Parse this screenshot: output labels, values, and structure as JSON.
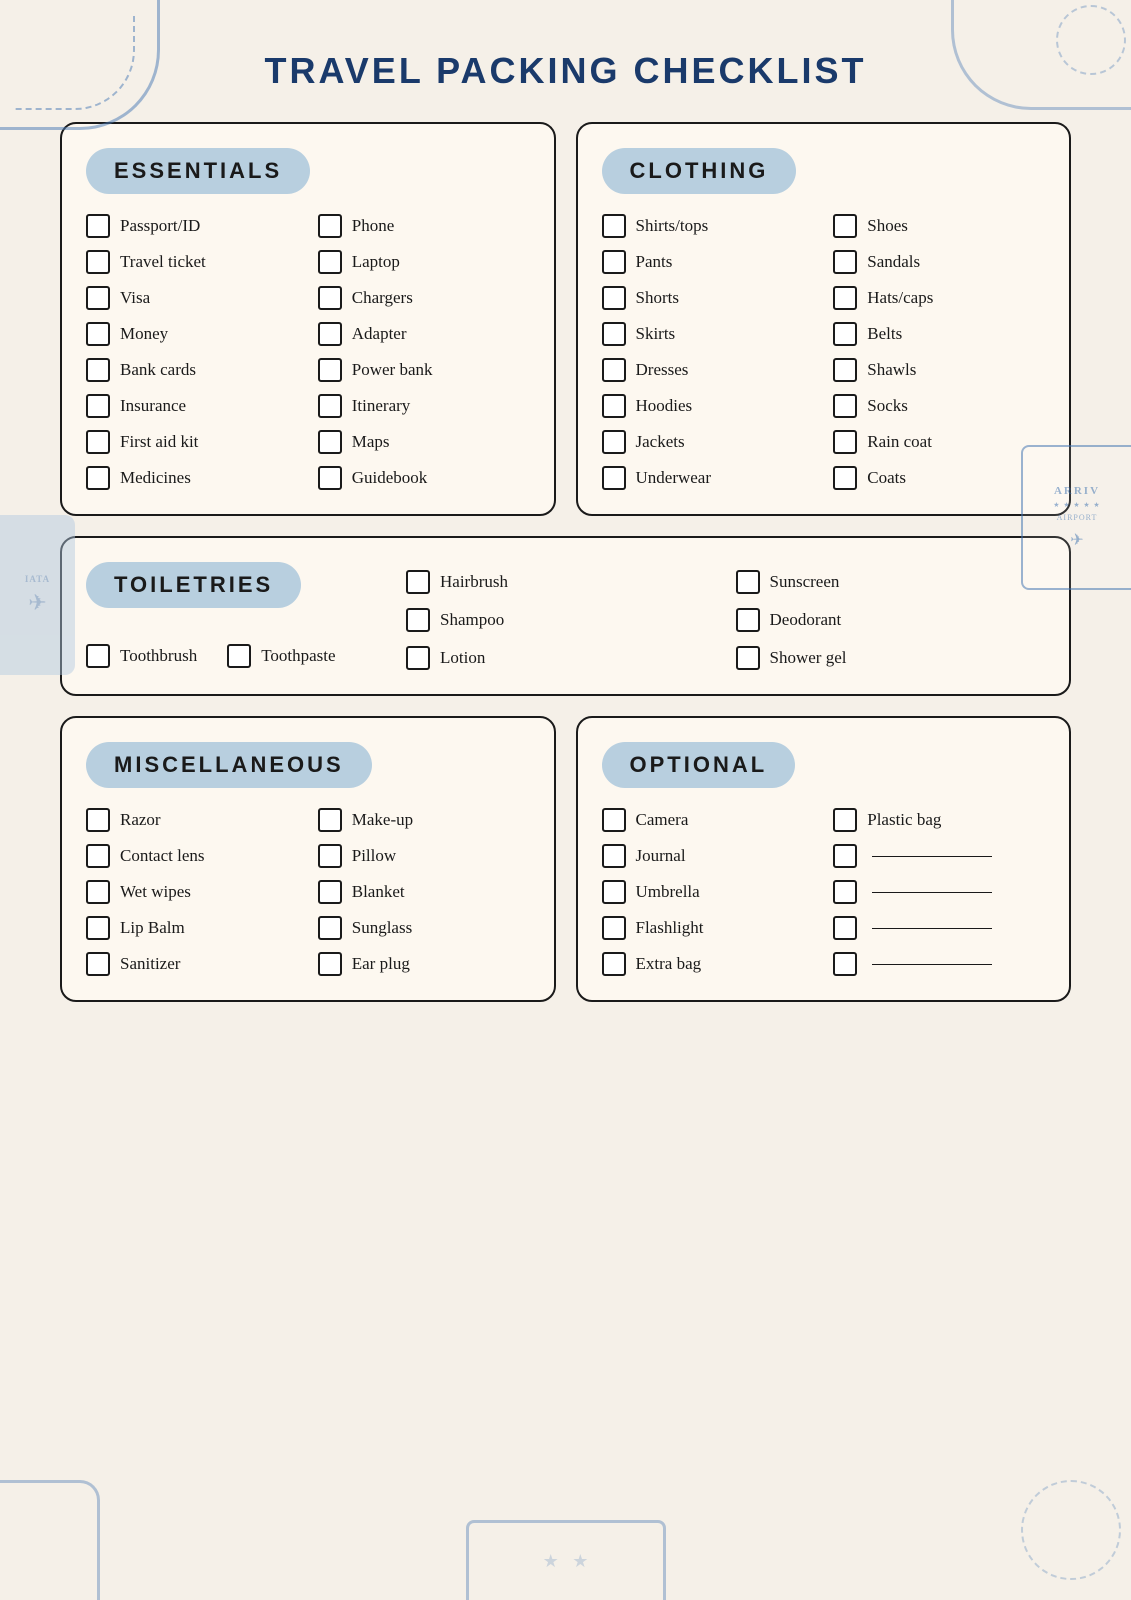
{
  "page": {
    "title": "TRAVEL PACKING CHECKLIST",
    "background_color": "#f5f0e8"
  },
  "sections": {
    "essentials": {
      "header": "ESSENTIALS",
      "items_col1": [
        "Passport/ID",
        "Travel ticket",
        "Visa",
        "Money",
        "Bank cards",
        "Insurance",
        "First aid kit",
        "Medicines"
      ],
      "items_col2": [
        "Phone",
        "Laptop",
        "Chargers",
        "Adapter",
        "Power bank",
        "Itinerary",
        "Maps",
        "Guidebook"
      ]
    },
    "clothing": {
      "header": "CLOTHING",
      "items_col1": [
        "Shirts/tops",
        "Pants",
        "Shorts",
        "Skirts",
        "Dresses",
        "Hoodies",
        "Jackets",
        "Underwear"
      ],
      "items_col2": [
        "Shoes",
        "Sandals",
        "Hats/caps",
        "Belts",
        "Shawls",
        "Socks",
        "Rain coat",
        "Coats"
      ]
    },
    "toiletries": {
      "header": "TOILETRIES",
      "basic_items": [
        "Toothbrush",
        "Toothpaste"
      ],
      "extra_col1": [
        "Hairbrush",
        "Shampoo",
        "Lotion"
      ],
      "extra_col2": [
        "Sunscreen",
        "Deodorant",
        "Shower gel"
      ]
    },
    "miscellaneous": {
      "header": "MISCELLANEOUS",
      "items_col1": [
        "Razor",
        "Contact lens",
        "Wet wipes",
        "Lip Balm",
        "Sanitizer"
      ],
      "items_col2": [
        "Make-up",
        "Pillow",
        "Blanket",
        "Sunglass",
        "Ear plug"
      ]
    },
    "optional": {
      "header": "OPTIONAL",
      "items_col1": [
        "Camera",
        "Journal",
        "Umbrella",
        "Flashlight",
        "Extra bag"
      ],
      "items_col2": [
        "Plastic bag",
        "",
        "",
        "",
        ""
      ]
    }
  },
  "decorative": {
    "arrival_label": "ARRIV",
    "airport_label": "AIRPORT",
    "iata_label": "IATA",
    "stars": "★ ★ ★ ★ ★"
  }
}
